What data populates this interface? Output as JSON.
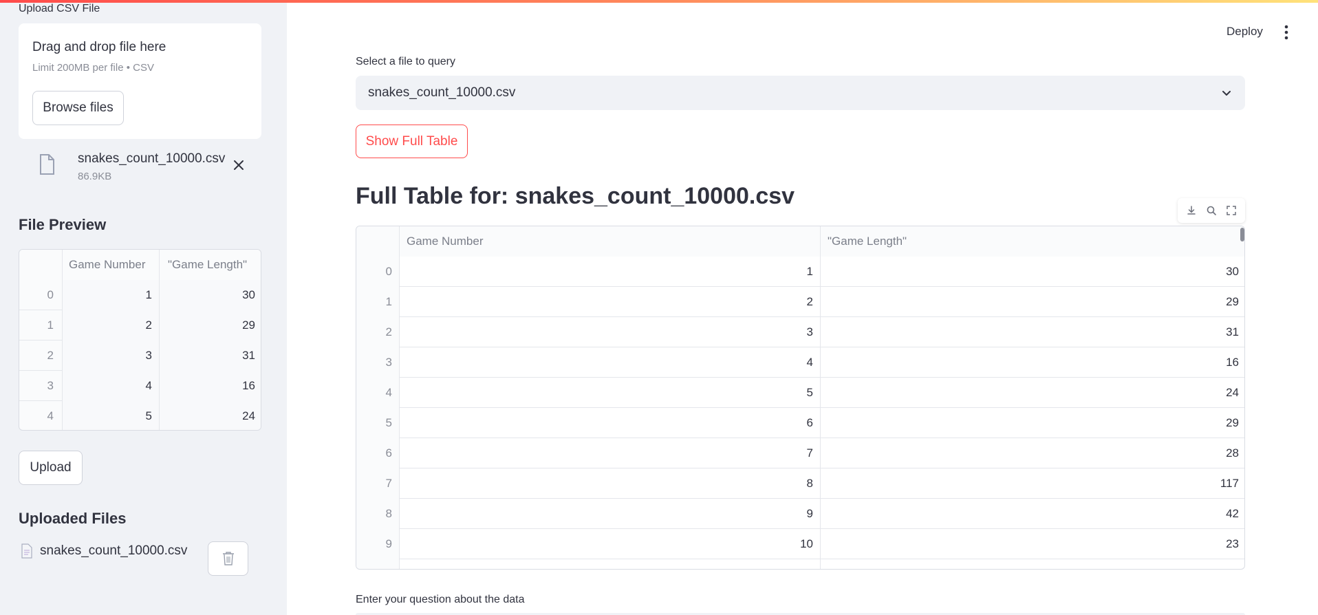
{
  "sidebar": {
    "upload_label": "Upload CSV File",
    "dropzone": {
      "title": "Drag and drop file here",
      "subtitle": "Limit 200MB per file • CSV",
      "browse_label": "Browse files"
    },
    "selected_file": {
      "name": "snakes_count_10000.csv",
      "size": "86.9KB"
    },
    "preview": {
      "title": "File Preview",
      "columns": [
        "Game Number",
        "\"Game Length\""
      ],
      "rows": [
        {
          "index": "0",
          "values": [
            "1",
            "30"
          ]
        },
        {
          "index": "1",
          "values": [
            "2",
            "29"
          ]
        },
        {
          "index": "2",
          "values": [
            "3",
            "31"
          ]
        },
        {
          "index": "3",
          "values": [
            "4",
            "16"
          ]
        },
        {
          "index": "4",
          "values": [
            "5",
            "24"
          ]
        }
      ]
    },
    "upload_button": "Upload",
    "uploaded": {
      "title": "Uploaded Files",
      "files": [
        "snakes_count_10000.csv"
      ]
    }
  },
  "header": {
    "deploy_label": "Deploy",
    "menu_icon": "more-vertical-icon"
  },
  "main": {
    "select_label": "Select a file to query",
    "select_value": "snakes_count_10000.csv",
    "show_button": "Show Full Table",
    "full_title": "Full Table for: snakes_count_10000.csv",
    "table": {
      "columns": [
        "Game Number",
        "\"Game Length\""
      ],
      "rows": [
        {
          "index": "0",
          "values": [
            "1",
            "30"
          ]
        },
        {
          "index": "1",
          "values": [
            "2",
            "29"
          ]
        },
        {
          "index": "2",
          "values": [
            "3",
            "31"
          ]
        },
        {
          "index": "3",
          "values": [
            "4",
            "16"
          ]
        },
        {
          "index": "4",
          "values": [
            "5",
            "24"
          ]
        },
        {
          "index": "5",
          "values": [
            "6",
            "29"
          ]
        },
        {
          "index": "6",
          "values": [
            "7",
            "28"
          ]
        },
        {
          "index": "7",
          "values": [
            "8",
            "117"
          ]
        },
        {
          "index": "8",
          "values": [
            "9",
            "42"
          ]
        },
        {
          "index": "9",
          "values": [
            "10",
            "23"
          ]
        }
      ]
    },
    "question_label": "Enter your question about the data"
  },
  "colors": {
    "accent": "#ff4b4b",
    "sidebar_bg": "#f0f2f6",
    "text": "#31333f"
  }
}
